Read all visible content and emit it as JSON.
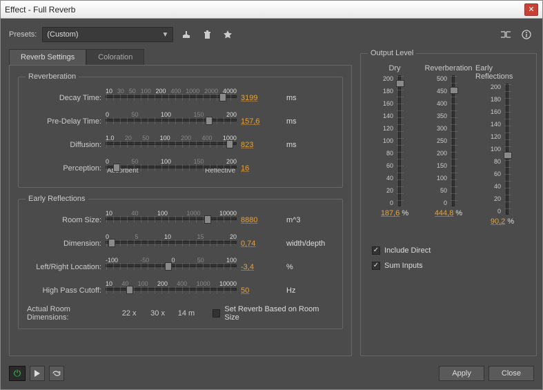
{
  "window": {
    "title": "Effect - Full Reverb"
  },
  "presets": {
    "label": "Presets:",
    "value": "(Custom)"
  },
  "tabs": {
    "settings": "Reverb Settings",
    "coloration": "Coloration"
  },
  "groups": {
    "reverberation": "Reverberation",
    "early": "Early Reflections",
    "output": "Output Level"
  },
  "reverb": {
    "decay": {
      "label": "Decay Time:",
      "ticks": [
        "10",
        "30",
        "50",
        "100",
        "200",
        "400",
        "1000",
        "2000",
        "4000"
      ],
      "value": "3199",
      "unit": "ms",
      "pos": 90
    },
    "predelay": {
      "label": "Pre-Delay Time:",
      "ticks": [
        "0",
        "50",
        "100",
        "150",
        "200"
      ],
      "value": "157,6",
      "unit": "ms",
      "pos": 79
    },
    "diffusion": {
      "label": "Diffusion:",
      "ticks": [
        "1.0",
        "20",
        "50",
        "100",
        "200",
        "400",
        "1000"
      ],
      "value": "823",
      "unit": "ms",
      "pos": 95
    },
    "perception": {
      "label": "Perception:",
      "ticks": [
        "0",
        "50",
        "100",
        "150",
        "200"
      ],
      "value": "16",
      "unit": "",
      "pos": 8,
      "extraLeft": "Absorbent",
      "extraRight": "Reflective"
    }
  },
  "early": {
    "roomsize": {
      "label": "Room Size:",
      "ticks": [
        "10",
        "40",
        "100",
        "1000",
        "10000"
      ],
      "value": "8880",
      "unit": "m^3",
      "pos": 78
    },
    "dimension": {
      "label": "Dimension:",
      "ticks": [
        "0",
        "5",
        "10",
        "15",
        "20"
      ],
      "value": "0,74",
      "unit": "width/depth",
      "pos": 4
    },
    "lr": {
      "label": "Left/Right Location:",
      "ticks": [
        "-100",
        "-50",
        "0",
        "50",
        "100"
      ],
      "value": "-3,4",
      "unit": "%",
      "pos": 48
    },
    "hpf": {
      "label": "High Pass Cutoff:",
      "ticks": [
        "10",
        "40",
        "100",
        "200",
        "400",
        "1000",
        "10000"
      ],
      "value": "50",
      "unit": "Hz",
      "pos": 18
    }
  },
  "actual": {
    "label": "Actual Room Dimensions:",
    "x": "22 x",
    "y": "30 x",
    "z": "14 m",
    "checkbox": "Set Reverb Based on Room Size",
    "checked": false
  },
  "output": {
    "cols": [
      {
        "name": "Dry",
        "ticks": [
          "200",
          "180",
          "160",
          "140",
          "120",
          "100",
          "80",
          "60",
          "40",
          "20",
          "0"
        ],
        "value": "187,6",
        "pos": 6
      },
      {
        "name": "Reverberation",
        "ticks": [
          "500",
          "450",
          "400",
          "350",
          "300",
          "250",
          "200",
          "150",
          "100",
          "50",
          "0"
        ],
        "value": "444,8",
        "pos": 11
      },
      {
        "name": "Early Reflections",
        "ticks": [
          "200",
          "180",
          "160",
          "140",
          "120",
          "100",
          "80",
          "60",
          "40",
          "20",
          "0"
        ],
        "value": "90,2",
        "pos": 55
      }
    ],
    "pctUnit": "%",
    "includeDirect": {
      "label": "Include Direct",
      "checked": true
    },
    "sumInputs": {
      "label": "Sum  Inputs",
      "checked": true
    }
  },
  "footer": {
    "apply": "Apply",
    "close": "Close"
  }
}
